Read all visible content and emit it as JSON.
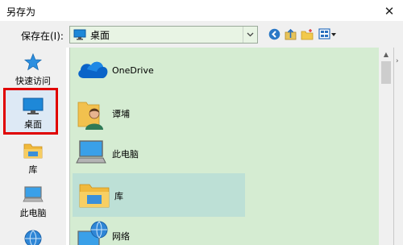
{
  "window": {
    "title": "另存为",
    "close_glyph": "✕"
  },
  "toolbar": {
    "save_in_label": "保存在(I):",
    "location": "桌面",
    "location_icon": "desktop-icon",
    "icons": [
      "back-icon",
      "up-folder-icon",
      "new-folder-icon",
      "view-menu-icon"
    ]
  },
  "nav": {
    "items": [
      {
        "label": "快速访问",
        "icon": "star-icon"
      },
      {
        "label": "桌面",
        "icon": "desktop-icon",
        "selected": true
      },
      {
        "label": "库",
        "icon": "library-icon"
      },
      {
        "label": "此电脑",
        "icon": "computer-icon"
      },
      {
        "label": "",
        "icon": "network-icon"
      }
    ]
  },
  "files": {
    "items": [
      {
        "label": "OneDrive",
        "icon": "onedrive-icon"
      },
      {
        "label": "谭埔",
        "icon": "user-folder-icon"
      },
      {
        "label": "此电脑",
        "icon": "computer-icon"
      },
      {
        "label": "库",
        "icon": "library-icon",
        "hovered": true
      },
      {
        "label": "网络",
        "icon": "network-icon"
      }
    ]
  },
  "colors": {
    "list_background": "#d5ecd2",
    "hover_row": "#bde0d6",
    "selection_outline": "#e00000",
    "panel": "#f0f0f0"
  },
  "scrollbar": {
    "up_glyph": "▲"
  },
  "side_strip": {
    "glyph": "›"
  }
}
